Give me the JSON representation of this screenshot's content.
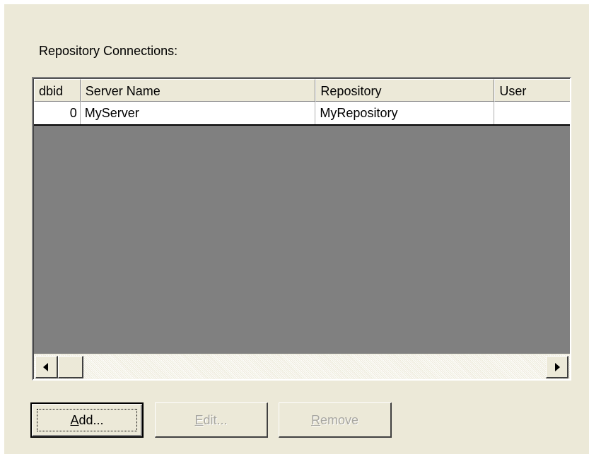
{
  "section_label": "Repository Connections:",
  "table": {
    "columns": [
      {
        "label": "dbid"
      },
      {
        "label": "Server Name"
      },
      {
        "label": "Repository"
      },
      {
        "label": "User"
      }
    ],
    "rows": [
      {
        "dbid": "0",
        "server": "MyServer",
        "repository": "MyRepository",
        "user": ""
      }
    ]
  },
  "scrollbar": {
    "left_icon": "arrow-left-icon",
    "right_icon": "arrow-right-icon"
  },
  "buttons": {
    "add": {
      "mnemonic": "A",
      "rest": "dd...",
      "enabled": true
    },
    "edit": {
      "mnemonic": "E",
      "rest": "dit...",
      "enabled": false
    },
    "remove": {
      "mnemonic": "R",
      "rest": "emove",
      "enabled": false
    }
  },
  "colors": {
    "dialog_bg": "#ece9d8",
    "grid_empty_bg": "#808080",
    "disabled_text": "#a7a6a0"
  }
}
